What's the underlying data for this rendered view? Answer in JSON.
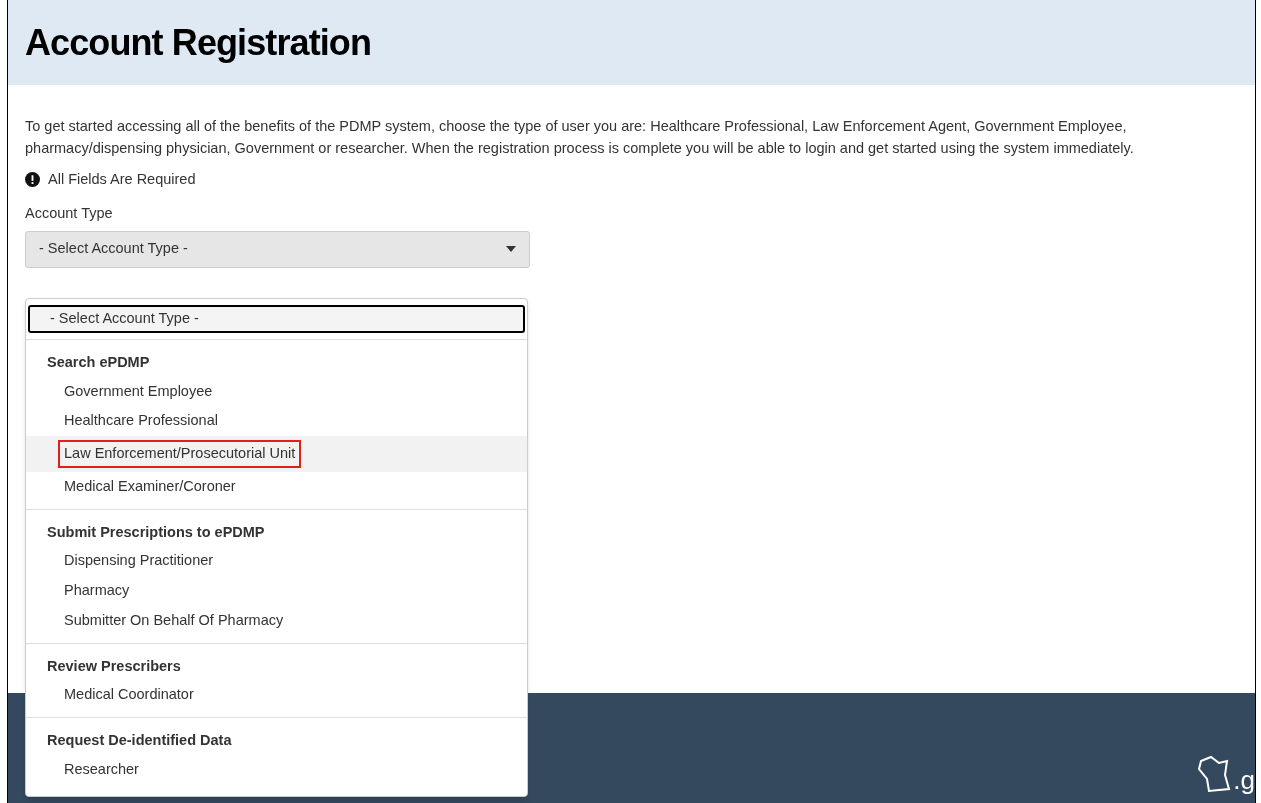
{
  "header": {
    "title": "Account Registration"
  },
  "intro": "To get started accessing all of the benefits of the PDMP system, choose the type of user you are: Healthcare Professional, Law Enforcement Agent, Government Employee, pharmacy/dispensing physician, Government or researcher. When the registration process is complete you will be able to login and get started using the system immediately.",
  "required_note": "All Fields Are Required",
  "account_type": {
    "label": "Account Type",
    "value": "- Select Account Type -",
    "options": [
      {
        "label": "- Select Account Type -",
        "selected": true,
        "highlighted": false
      }
    ],
    "groups": [
      {
        "label": "Search ePDMP",
        "options": [
          {
            "label": "Government Employee",
            "selected": false,
            "highlighted": false
          },
          {
            "label": "Healthcare Professional",
            "selected": false,
            "highlighted": false
          },
          {
            "label": "Law Enforcement/Prosecutorial Unit",
            "selected": false,
            "highlighted": true
          },
          {
            "label": "Medical Examiner/Coroner",
            "selected": false,
            "highlighted": false
          }
        ]
      },
      {
        "label": "Submit Prescriptions to ePDMP",
        "options": [
          {
            "label": "Dispensing Practitioner",
            "selected": false,
            "highlighted": false
          },
          {
            "label": "Pharmacy",
            "selected": false,
            "highlighted": false
          },
          {
            "label": "Submitter On Behalf Of Pharmacy",
            "selected": false,
            "highlighted": false
          }
        ]
      },
      {
        "label": "Review Prescribers",
        "options": [
          {
            "label": "Medical Coordinator",
            "selected": false,
            "highlighted": false
          }
        ]
      },
      {
        "label": "Request De-identified Data",
        "options": [
          {
            "label": "Researcher",
            "selected": false,
            "highlighted": false
          }
        ]
      }
    ]
  },
  "footer": {
    "gov_logo_text": ".g"
  }
}
